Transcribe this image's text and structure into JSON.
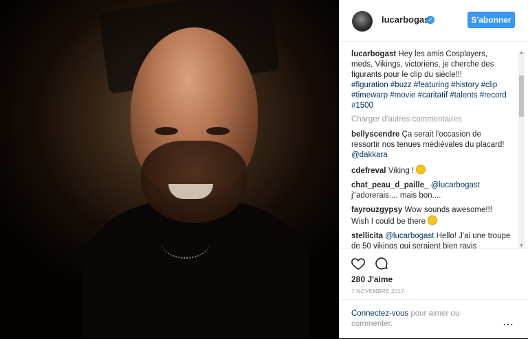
{
  "post": {
    "username": "lucarbogast",
    "follow_label": "S'abonner",
    "caption_user": "lucarbogast",
    "caption_text": "Hey les amis Cosplayers, meds, Vikings, victoriens, je cherche des figurants pour le clip du siècle!!!",
    "hashtags": [
      "#figuration",
      "#buzz",
      "#featuring",
      "#history",
      "#clip",
      "#timewarp",
      "#movie",
      "#caritatif",
      "#talents",
      "#record",
      "#1500"
    ],
    "load_more": "Charger d'autres commentaires",
    "comments": [
      {
        "user": "bellyscendre",
        "text": "Ça serait l'occasion de ressortir nos tenues médiévales du placard!",
        "mention": "@dakkara"
      },
      {
        "user": "cdefreval",
        "text": "Viking !"
      },
      {
        "user": "chat_peau_d_paille_",
        "mention": "@lucarbogast",
        "text": "j''adorerais.... mais bon...."
      },
      {
        "user": "fayrouzgypsy",
        "text": "Wow sounds awesome!!! Wish I could be there"
      },
      {
        "user": "stellicita",
        "mention": "@lucarbogast",
        "text": "Hello! J'ai une troupe de 50 vikings qui seraient bien ravis"
      }
    ],
    "likes": "280 J'aime",
    "date": "7 NOVEMBRE 2017",
    "login_link": "Connectez-vous",
    "login_rest": "pour aimer ou commenter.",
    "more_icon": "⋯"
  },
  "icons": {
    "avatar": "avatar",
    "verified": "verified-badge-icon",
    "heart": "heart-icon",
    "comment": "comment-bubble-icon",
    "more": "more-options-icon"
  },
  "colors": {
    "accent": "#3897f0",
    "link": "#003569",
    "muted": "#999999",
    "text": "#262626"
  }
}
